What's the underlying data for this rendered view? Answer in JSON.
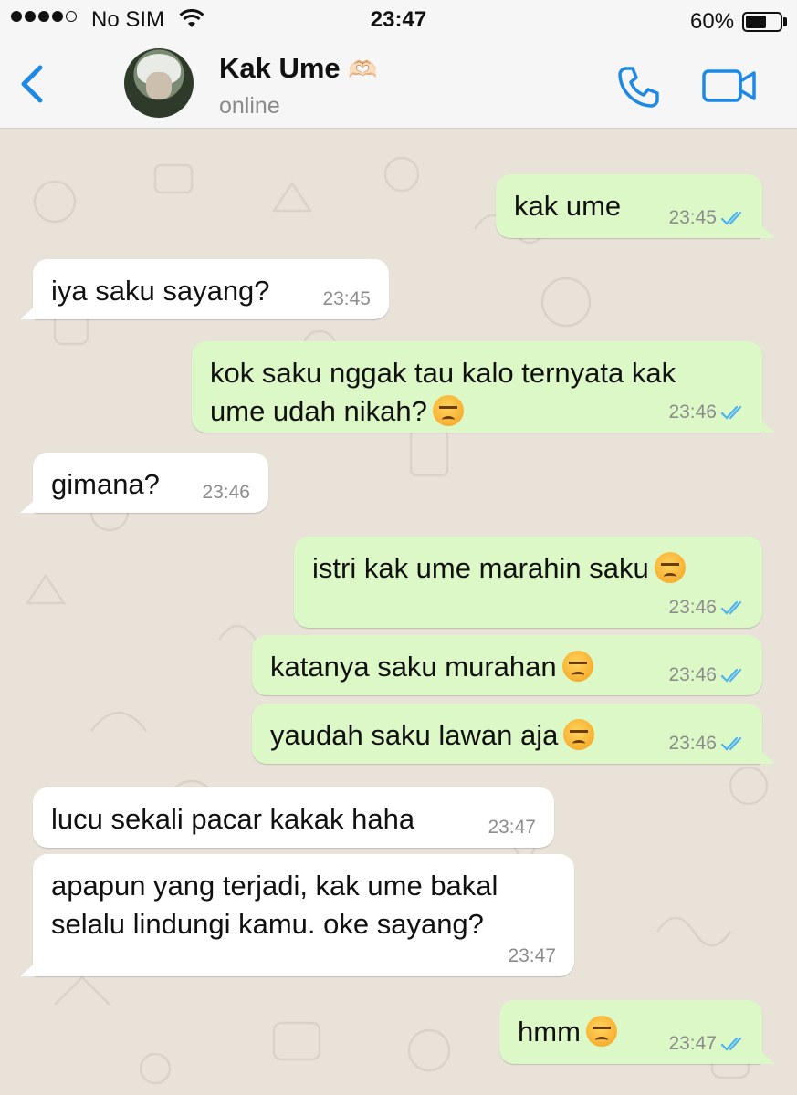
{
  "status_bar": {
    "carrier": "No SIM",
    "time": "23:47",
    "battery": "60%",
    "battery_level": 0.6
  },
  "header": {
    "contact_name": "Kak Ume",
    "name_emoji": "🫶🏻",
    "status": "online"
  },
  "messages": [
    {
      "dir": "out",
      "text": "kak ume",
      "time": "23:45",
      "read": true
    },
    {
      "dir": "in",
      "text": "iya saku sayang?",
      "time": "23:45"
    },
    {
      "dir": "out",
      "text": "kok saku nggak tau kalo ternyata kak\nume udah nikah?",
      "emoji": "angry",
      "time": "23:46",
      "read": true
    },
    {
      "dir": "in",
      "text": "gimana?",
      "time": "23:46"
    },
    {
      "dir": "out",
      "text": "istri kak ume marahin saku",
      "emoji": "angry",
      "time": "23:46",
      "read": true
    },
    {
      "dir": "out",
      "text": "katanya saku murahan",
      "emoji": "angry",
      "time": "23:46",
      "read": true
    },
    {
      "dir": "out",
      "text": "yaudah saku lawan aja",
      "emoji": "angry",
      "time": "23:46",
      "read": true
    },
    {
      "dir": "in",
      "text": "lucu sekali pacar kakak haha",
      "time": "23:47"
    },
    {
      "dir": "in",
      "text": "apapun yang terjadi, kak ume bakal\nselalu lindungi kamu. oke sayang?",
      "time": "23:47"
    },
    {
      "dir": "out",
      "text": "hmm",
      "emoji": "angry",
      "time": "23:47",
      "read": true
    }
  ],
  "colors": {
    "accent": "#1e88e5",
    "outgoing_bubble": "#dcf8c6",
    "incoming_bubble": "#ffffff",
    "read_ticks": "#4fb3f0",
    "chat_bg": "#e8e2d9"
  },
  "icons": {
    "back": "chevron-left-icon",
    "call": "phone-icon",
    "video": "video-camera-icon",
    "wifi": "wifi-icon",
    "battery": "battery-icon",
    "read": "double-check-icon",
    "angry_emoji": "angry-face-icon"
  }
}
